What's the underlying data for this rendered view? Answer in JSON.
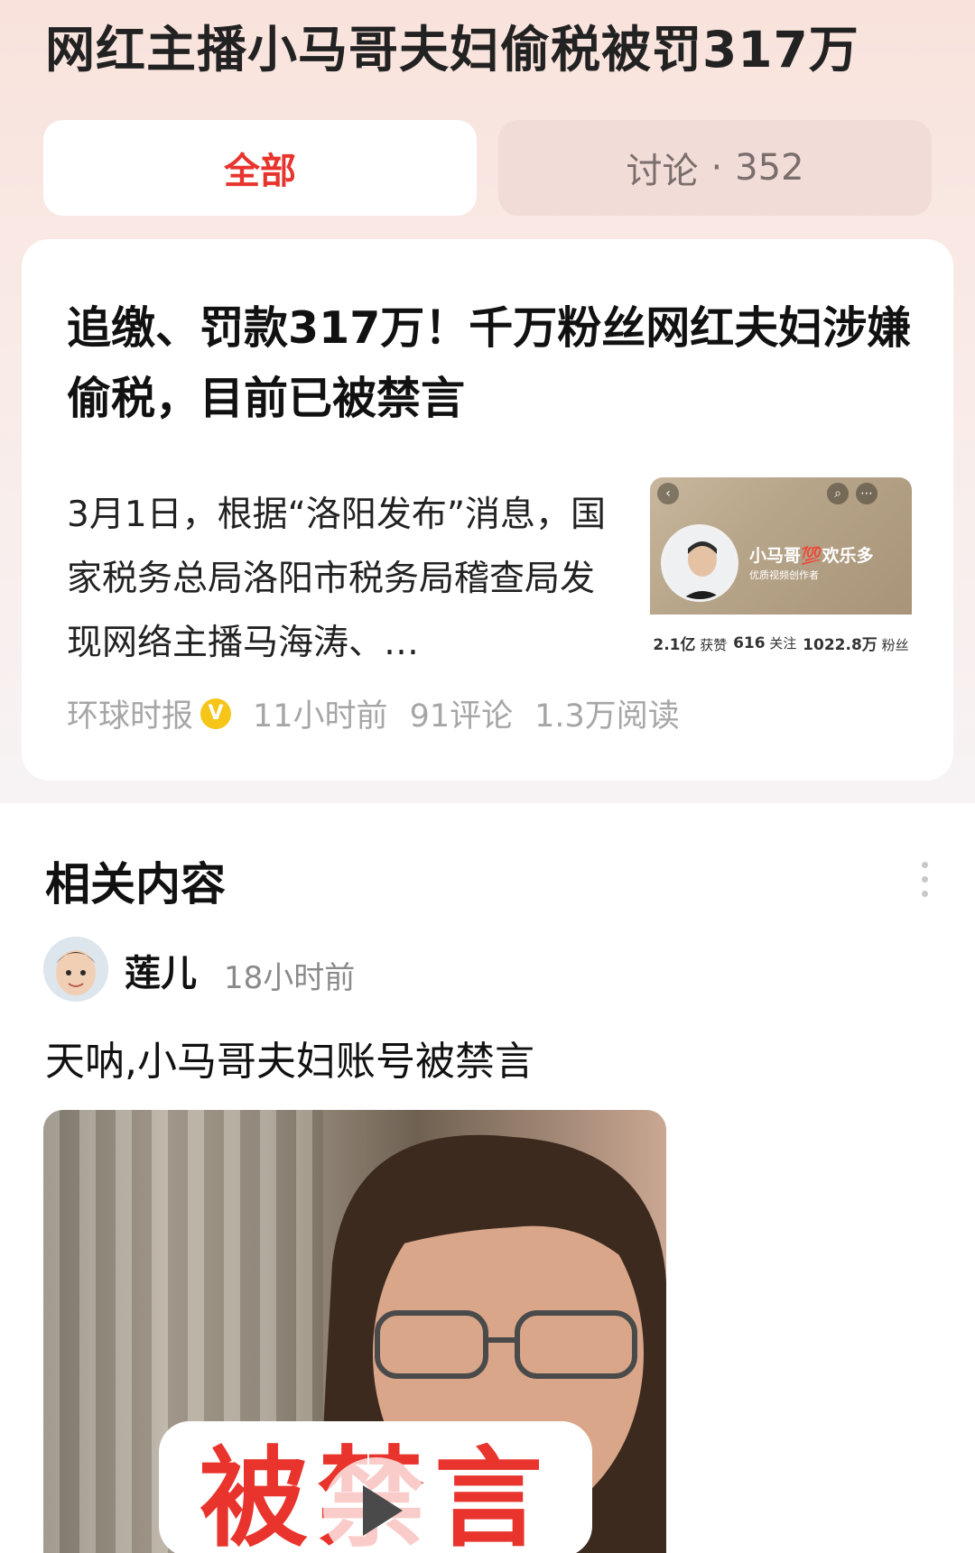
{
  "topic": {
    "title": "网红主播小马哥夫妇偷税被罚317万"
  },
  "tabs": [
    {
      "label": "全部",
      "active": true
    },
    {
      "label": "讨论",
      "separator": "·",
      "count": "352",
      "active": false
    }
  ],
  "article": {
    "title": "追缴、罚款317万！千万粉丝网红夫妇涉嫌偷税，目前已被禁言",
    "summary": "3月1日，根据“洛阳发布”消息，国家税务总局洛阳市税务局稽查局发现网络主播马海涛、…",
    "source": "环球时报",
    "verified_badge": "V",
    "time": "11小时前",
    "comments": "91评论",
    "reads": "1.3万阅读",
    "thumbnail": {
      "name": "小马哥💯欢乐多",
      "badge": "优质视频创作者",
      "likes_value": "2.1亿",
      "likes_label": "获赞",
      "following_value": "616",
      "following_label": "关注",
      "fans_value": "1022.8万",
      "fans_label": "粉丝"
    }
  },
  "related": {
    "title": "相关内容",
    "post": {
      "author": "莲儿",
      "time": "18小时前",
      "text": "天呐,小马哥夫妇账号被禁言",
      "video_overlay_text": "被禁言"
    }
  },
  "colors": {
    "accent": "#e8342d",
    "verified": "#f5c518",
    "meta_gray": "#a6a6a6"
  }
}
